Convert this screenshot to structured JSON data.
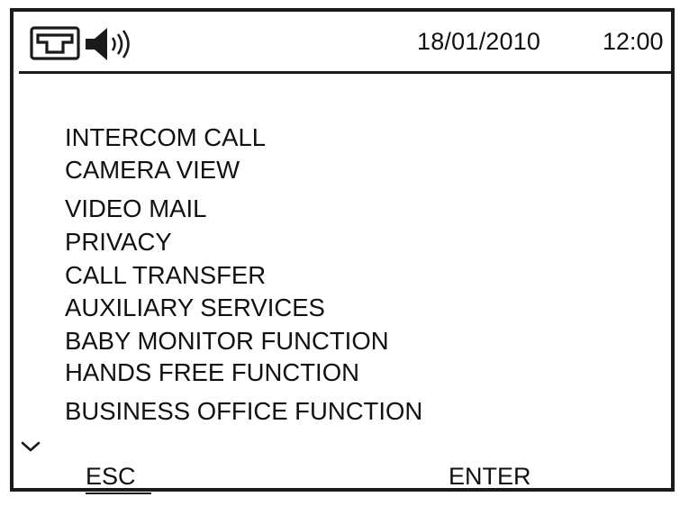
{
  "status_bar": {
    "icons": [
      "intercom-handset-icon",
      "speaker-volume-icon"
    ],
    "date": "18/01/2010",
    "time": "12:00"
  },
  "menu": {
    "items": [
      {
        "label": "INTERCOM CALL"
      },
      {
        "label": "CAMERA VIEW"
      },
      {
        "label": "VIDEO MAIL"
      },
      {
        "label": "PRIVACY"
      },
      {
        "label": "CALL TRANSFER"
      },
      {
        "label": "AUXILIARY SERVICES"
      },
      {
        "label": "BABY MONITOR FUNCTION"
      },
      {
        "label": "HANDS FREE FUNCTION"
      },
      {
        "label": "BUSINESS OFFICE FUNCTION"
      }
    ],
    "scroll_indicator_icon": "chevron-down-icon"
  },
  "softkeys": {
    "esc_label": "ESC",
    "enter_label": "ENTER"
  }
}
